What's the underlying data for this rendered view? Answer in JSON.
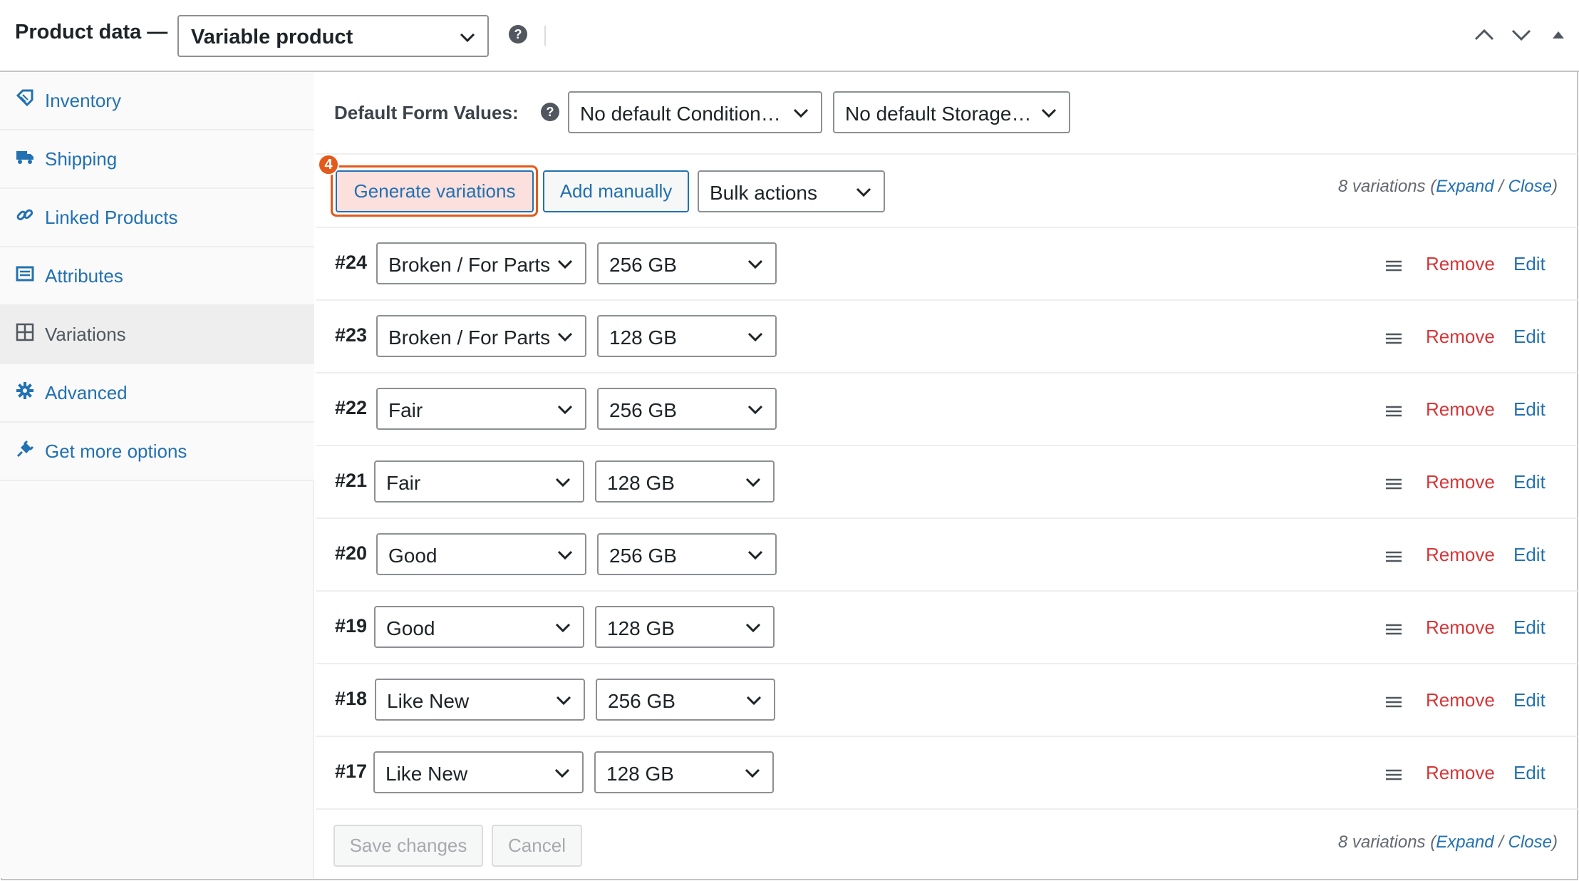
{
  "header": {
    "title": "Product data —",
    "product_type": "Variable product",
    "help": "?"
  },
  "sidebar": {
    "items": [
      {
        "label": "Inventory",
        "icon": "inventory-icon"
      },
      {
        "label": "Shipping",
        "icon": "truck-icon"
      },
      {
        "label": "Linked Products",
        "icon": "link-icon"
      },
      {
        "label": "Attributes",
        "icon": "list-icon"
      },
      {
        "label": "Variations",
        "icon": "grid-icon",
        "active": true
      },
      {
        "label": "Advanced",
        "icon": "gear-icon"
      },
      {
        "label": "Get more options",
        "icon": "plugin-icon"
      }
    ]
  },
  "defaults": {
    "label": "Default Form Values:",
    "help": "?",
    "condition": "No default Condition…",
    "storage": "No default Storage…"
  },
  "toolbar": {
    "generate": "Generate variations",
    "add_manually": "Add manually",
    "bulk_actions": "Bulk actions",
    "step_number": "4"
  },
  "counts": {
    "summary": "8 variations (",
    "expand": "Expand",
    "sep": " / ",
    "close": "Close",
    "end": ")"
  },
  "variations": [
    {
      "id": "#24",
      "condition": "Broken / For Parts",
      "storage": "256 GB"
    },
    {
      "id": "#23",
      "condition": "Broken / For Parts",
      "storage": "128 GB"
    },
    {
      "id": "#22",
      "condition": "Fair",
      "storage": "256 GB"
    },
    {
      "id": "#21",
      "condition": "Fair",
      "storage": "128 GB"
    },
    {
      "id": "#20",
      "condition": "Good",
      "storage": "256 GB"
    },
    {
      "id": "#19",
      "condition": "Good",
      "storage": "128 GB"
    },
    {
      "id": "#18",
      "condition": "Like New",
      "storage": "256 GB"
    },
    {
      "id": "#17",
      "condition": "Like New",
      "storage": "128 GB"
    }
  ],
  "row_actions": {
    "remove": "Remove",
    "edit": "Edit"
  },
  "footer": {
    "save": "Save changes",
    "cancel": "Cancel"
  },
  "colors": {
    "link": "#2271b1",
    "remove": "#d63638",
    "highlight": "#e35a1a"
  }
}
